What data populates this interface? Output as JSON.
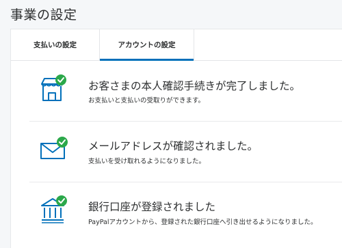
{
  "page": {
    "title": "事業の設定"
  },
  "tabs": [
    {
      "label": "支払いの設定",
      "active": false
    },
    {
      "label": "アカウントの設定",
      "active": true
    }
  ],
  "rows": [
    {
      "icon": "storefront-check-icon",
      "title": "お客さまの本人確認手続きが完了しました。",
      "description": "お支払いと支払いの受取りができます。"
    },
    {
      "icon": "envelope-check-icon",
      "title": "メールアドレスが確認されました。",
      "description": "支払いを受け取れるようになりました。"
    },
    {
      "icon": "bank-check-icon",
      "title": "銀行口座が登録されました",
      "description": "PayPalアカウントから、登録された銀行口座へ引き出せるようになりました。"
    }
  ],
  "colors": {
    "icon_outline": "#0070ba",
    "check_badge": "#2ba84a",
    "active_tab_underline": "#0070ba"
  }
}
